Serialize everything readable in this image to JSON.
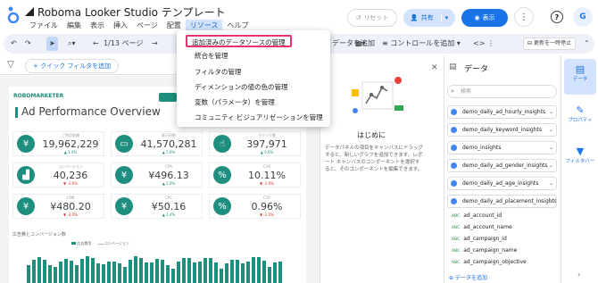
{
  "app": {
    "title": "Roboma Looker Studio テンプレート",
    "menus": [
      "ファイル",
      "編集",
      "表示",
      "挿入",
      "ページ",
      "配置",
      "リソース",
      "ヘルプ"
    ],
    "active_menu_index": 6,
    "reset_label": "リセット",
    "share_label": "共有",
    "view_label": "表示"
  },
  "toolbar": {
    "page_indicator": "1/13 ページ",
    "add_data_label": "データを追加",
    "add_control_label": "コントロールを追加",
    "pause_updates_label": "更新を一時停止"
  },
  "filterbar": {
    "quick_filter_label": "+ クイック フィルタを追加"
  },
  "resource_menu": {
    "items": [
      "追加済みのデータソースの管理",
      "統合を管理",
      "フィルタの管理",
      "ディメンションの値の色の管理",
      "変数（パラメータ）を管理",
      "コミュニティ ビジュアリゼーションを管理"
    ],
    "highlighted_index": 0
  },
  "report": {
    "brand": "ROBOMARKETER",
    "title": "Ad Performance Overview",
    "kpis": [
      {
        "icon": "¥",
        "label": "ご利用金額",
        "value": "19,962,229",
        "delta": "▲ 1.4%",
        "negative": false
      },
      {
        "icon": "▭",
        "label": "表示回数",
        "value": "41,570,281",
        "delta": "▲ 5.0%",
        "negative": false
      },
      {
        "icon": "☝",
        "label": "クリック数",
        "value": "397,971",
        "delta": "▲ 0.0%",
        "negative": false
      },
      {
        "icon": "▟",
        "label": "コンバージョン",
        "value": "40,236",
        "delta": "▼ -1.0%",
        "negative": true
      },
      {
        "icon": "¥",
        "label": "CPA",
        "value": "¥496.13",
        "delta": "▲ 1.0%",
        "negative": false
      },
      {
        "icon": "%",
        "label": "CVR",
        "value": "10.11%",
        "delta": "▼ -1.0%",
        "negative": true
      },
      {
        "icon": "¥",
        "label": "CPM",
        "value": "¥480.20",
        "delta": "▼ -3.4%",
        "negative": true
      },
      {
        "icon": "¥",
        "label": "CPC",
        "value": "¥50.16",
        "delta": "▲ 1.4%",
        "negative": false
      },
      {
        "icon": "%",
        "label": "CTR",
        "value": "0.96%",
        "delta": "▼ -1.0%",
        "negative": true
      }
    ],
    "chart_title": "広告費とコンバージョン数",
    "chart_legend": [
      "広告費用",
      "コンバージョン"
    ]
  },
  "welcome": {
    "title": "はじめに",
    "body": "データパネルの項目をキャンバスにドラッグすると、新しいグラフを追加できます。レポート キャンバスのコンポーネントを選択すると、そのコンポーネントを編集できます。"
  },
  "data_panel": {
    "title": "データ",
    "search_placeholder": "検索",
    "sources": [
      "demo_daily_ad_hourly_insights",
      "demo_daily_keyword_insights",
      "demo_insights",
      "demo_daily_ad_gender_insights",
      "demo_daily_ad_age_insights",
      "demo_daily_ad_placement_insights"
    ],
    "fields": [
      {
        "type": "ABC",
        "name": "ad_account_id"
      },
      {
        "type": "ABC",
        "name": "ad_account_name"
      },
      {
        "type": "ABC",
        "name": "ad_campaign_id"
      },
      {
        "type": "ABC",
        "name": "ad_campaign_name"
      },
      {
        "type": "ABC",
        "name": "ad_campaign_objective"
      }
    ],
    "add_data_label": "データを追加"
  },
  "side_tabs": [
    {
      "label": "データ",
      "icon": "▤",
      "active": true
    },
    {
      "label": "プロパティ",
      "icon": "✎",
      "active": false
    },
    {
      "label": "フィルタバー",
      "icon": "▼",
      "active": false
    }
  ],
  "colors": {
    "accent": "#1a73e8",
    "brand": "#1e8e7e",
    "highlight": "#e8336b"
  }
}
